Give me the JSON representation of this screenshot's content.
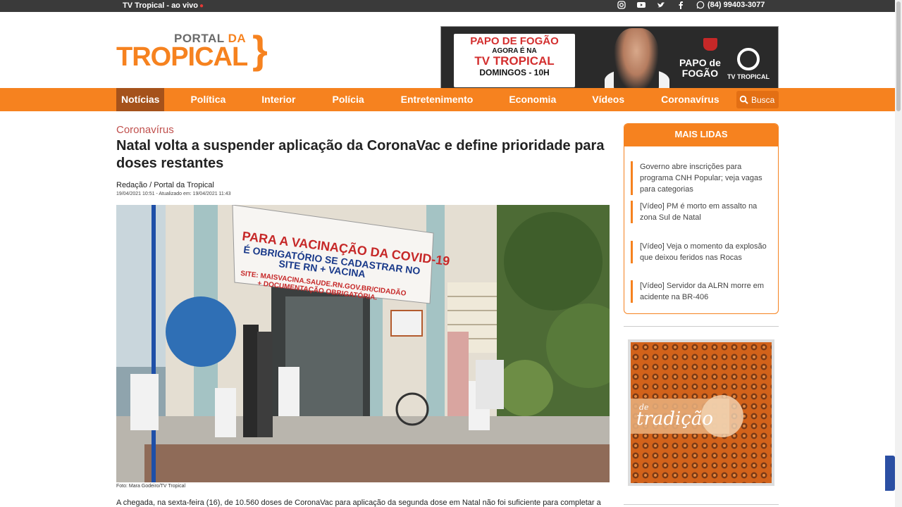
{
  "topbar": {
    "live_label": "TV Tropical - ao vivo",
    "phone": "(84) 99403-3077",
    "social_icons": [
      "instagram-icon",
      "youtube-icon",
      "twitter-icon",
      "facebook-icon",
      "whatsapp-icon"
    ]
  },
  "logo": {
    "portal": "PORTAL",
    "da": "DA",
    "tropical": "TROPICAL"
  },
  "banner": {
    "line1": "PAPO DE FOGÃO",
    "line2": "AGORA É NA",
    "line3": "TV TROPICAL",
    "line4": "DOMINGOS - 10H",
    "papo_title_1": "PAPO de",
    "papo_title_2": "FOGÃO",
    "channel": "TV TROPICAL"
  },
  "nav": {
    "items": [
      "Notícias",
      "Política",
      "Interior",
      "Polícia",
      "Entretenimento",
      "Economia",
      "Vídeos",
      "Coronavírus"
    ],
    "search_placeholder": "Busca"
  },
  "article": {
    "category": "Coronavírus",
    "title": "Natal volta a suspender aplicação da CoronaVac e define prioridade para doses restantes",
    "byline": "Redação / Portal da Tropical",
    "dates": "19/04/2021 10:51 - Atualizado em: 19/04/2021 11:43",
    "photo_sign": {
      "l1": "PARA A VACINAÇÃO DA COVID-19",
      "l2": "É OBRIGATÓRIO SE CADASTRAR NO",
      "l3": "SITE RN + VACINA",
      "l4": "SITE: MAISVACINA.SAUDE.RN.GOV.BR/CIDADÃO",
      "l5": "+ DOCUMENTAÇÃO OBRIGATÓRIA."
    },
    "photo_caption": "Foto: Mara Godeiro/TV Tropical",
    "body_first_line": "A chegada, na sexta-feira (16), de 10.560 doses de CoronaVac para aplicação da segunda dose em Natal não foi suficiente para completar a"
  },
  "sidebar": {
    "mais_lidas_title": "MAIS LIDAS",
    "items": [
      "Governo abre inscrições para programa CNH Popular; veja vagas para categorias",
      "[Vídeo] PM é morto em assalto na zona Sul de Natal",
      "[Vídeo] Veja o momento da explosão que deixou feridos nas Rocas",
      "[Vídeo] Servidor da ALRN morre em acidente na BR-406"
    ],
    "ad_small": "de",
    "ad_text": "tradição"
  },
  "colors": {
    "brand_orange": "#f6821f",
    "nav_active": "#a5521b",
    "category_red": "#c0504d"
  }
}
